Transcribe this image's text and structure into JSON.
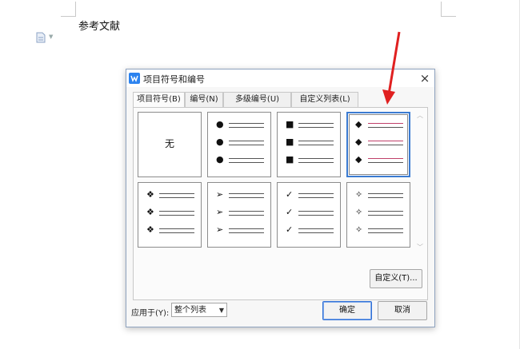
{
  "document": {
    "heading": "参考文献"
  },
  "dialog": {
    "title": "项目符号和编号",
    "close_glyph": "×",
    "tabs": [
      {
        "label": "项目符号(B)",
        "active": true
      },
      {
        "label": "编号(N)",
        "active": false
      },
      {
        "label": "多级编号(U)",
        "active": false
      },
      {
        "label": "自定义列表(L)",
        "active": false
      }
    ],
    "bullet_styles": [
      {
        "name": "none",
        "text": "无",
        "glyph": ""
      },
      {
        "name": "filled-circle",
        "text": "",
        "glyph": "●"
      },
      {
        "name": "filled-square",
        "text": "",
        "glyph": "■"
      },
      {
        "name": "diamond",
        "text": "",
        "glyph": "◆",
        "selected": true
      },
      {
        "name": "four-diamond",
        "text": "",
        "glyph": "❖"
      },
      {
        "name": "arrowhead",
        "text": "",
        "glyph": "➢"
      },
      {
        "name": "checkmark",
        "text": "",
        "glyph": "✓"
      },
      {
        "name": "four-point-star",
        "text": "",
        "glyph": "✧"
      }
    ],
    "customize_button": "自定义(T)...",
    "apply_label": "应用于(Y):",
    "apply_value": "整个列表",
    "ok_button": "确定",
    "cancel_button": "取消"
  },
  "colors": {
    "accent": "#3b7bd1",
    "arrow": "#e02020"
  }
}
